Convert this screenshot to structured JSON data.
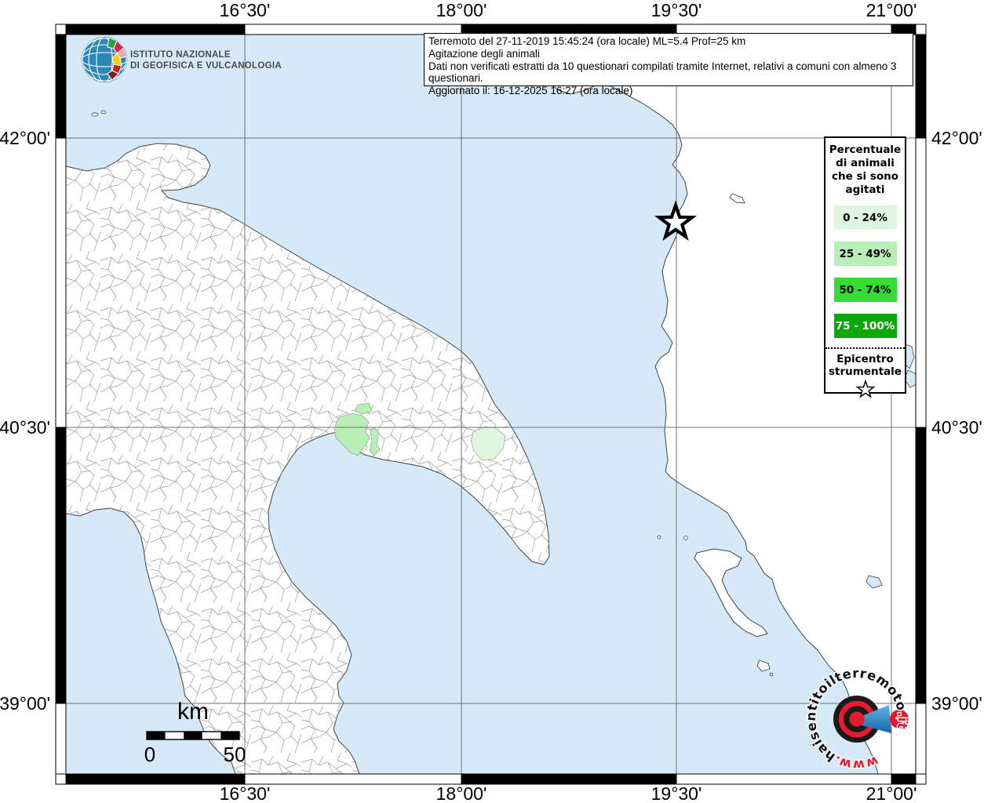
{
  "info_box": {
    "lines": [
      "Terremoto del 27-11-2019 15:45:24 (ora locale) ML=5.4 Prof=25 km",
      "Agitazione degli animali",
      "Dati non verificati estratti da 10 questionari compilati tramite Internet, relativi a comuni con almeno 3 questionari.",
      "Aggiornato il: 16-12-2025 16:27 (ora locale)"
    ]
  },
  "ingv_logo": {
    "line1": "ISTITUTO NAZIONALE",
    "line2": "DI GEOFISICA E VULCANOLOGIA"
  },
  "axis_labels": {
    "top": [
      "16°30'",
      "18°00'",
      "19°30'",
      "21°00'"
    ],
    "bottom": [
      "16°30'",
      "18°00'",
      "19°30'",
      "21°00'"
    ],
    "left": [
      "42°00'",
      "40°30'",
      "39°00'"
    ],
    "right": [
      "42°00'",
      "40°30'",
      "39°00'"
    ]
  },
  "legend": {
    "title_lines": [
      "Percentuale",
      "di animali",
      "che si sono",
      "agitati"
    ],
    "classes": [
      {
        "label": "0 - 24%",
        "color": "#dff7df",
        "text": "#000000"
      },
      {
        "label": "25 - 49%",
        "color": "#b7efb7",
        "text": "#000000"
      },
      {
        "label": "50 - 74%",
        "color": "#33dd33",
        "text": "#000000"
      },
      {
        "label": "75 - 100%",
        "color": "#0aa80a",
        "text": "#ffffff"
      }
    ],
    "epicenter_lines": [
      "Epicentro",
      "strumentale"
    ]
  },
  "scale_bar": {
    "unit": "km",
    "start_label": "0",
    "end_label": "50"
  },
  "map": {
    "sea_color": "#d5eaf6",
    "land_color": "#ffffff",
    "grid_color": "#707070",
    "epicenter_symbol": "star"
  },
  "watermark": {
    "prefix": "www.",
    "domain": "haisentitoilterremoto",
    "tld": ".it",
    "badge": "?",
    "red": "#e8192c",
    "blue": "#3fa8dc"
  }
}
